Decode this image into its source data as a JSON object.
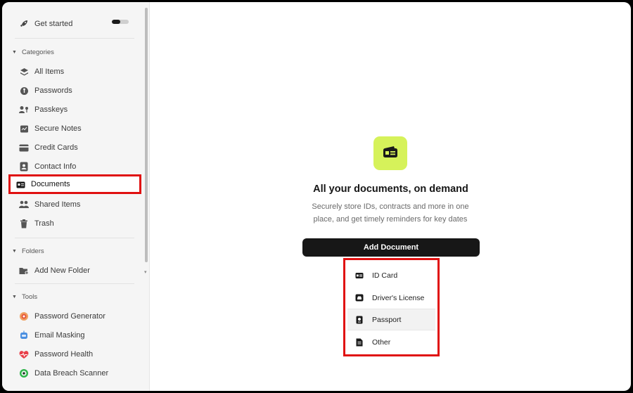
{
  "sidebar": {
    "get_started": "Get started",
    "categories_header": "Categories",
    "categories": [
      {
        "label": "All Items",
        "icon": "layers-icon"
      },
      {
        "label": "Passwords",
        "icon": "key-circle-icon"
      },
      {
        "label": "Passkeys",
        "icon": "passkey-icon"
      },
      {
        "label": "Secure Notes",
        "icon": "note-icon"
      },
      {
        "label": "Credit Cards",
        "icon": "credit-card-icon"
      },
      {
        "label": "Contact Info",
        "icon": "contact-icon"
      },
      {
        "label": "Documents",
        "icon": "id-card-icon"
      },
      {
        "label": "Shared Items",
        "icon": "shared-icon"
      },
      {
        "label": "Trash",
        "icon": "trash-icon"
      }
    ],
    "folders_header": "Folders",
    "add_folder": "Add New Folder",
    "tools_header": "Tools",
    "tools": [
      {
        "label": "Password Generator",
        "icon": "generator-icon"
      },
      {
        "label": "Email Masking",
        "icon": "robot-icon"
      },
      {
        "label": "Password Health",
        "icon": "heart-icon"
      },
      {
        "label": "Data Breach Scanner",
        "icon": "scanner-icon"
      }
    ]
  },
  "main": {
    "title": "All your documents, on demand",
    "subtitle": "Securely store IDs, contracts and more in one place, and get timely reminders for key dates",
    "add_button": "Add Document",
    "menu": [
      "ID Card",
      "Driver's License",
      "Passport",
      "Other"
    ]
  },
  "colors": {
    "accent": "#d6f25a",
    "highlight": "#e01010",
    "button": "#171717"
  }
}
